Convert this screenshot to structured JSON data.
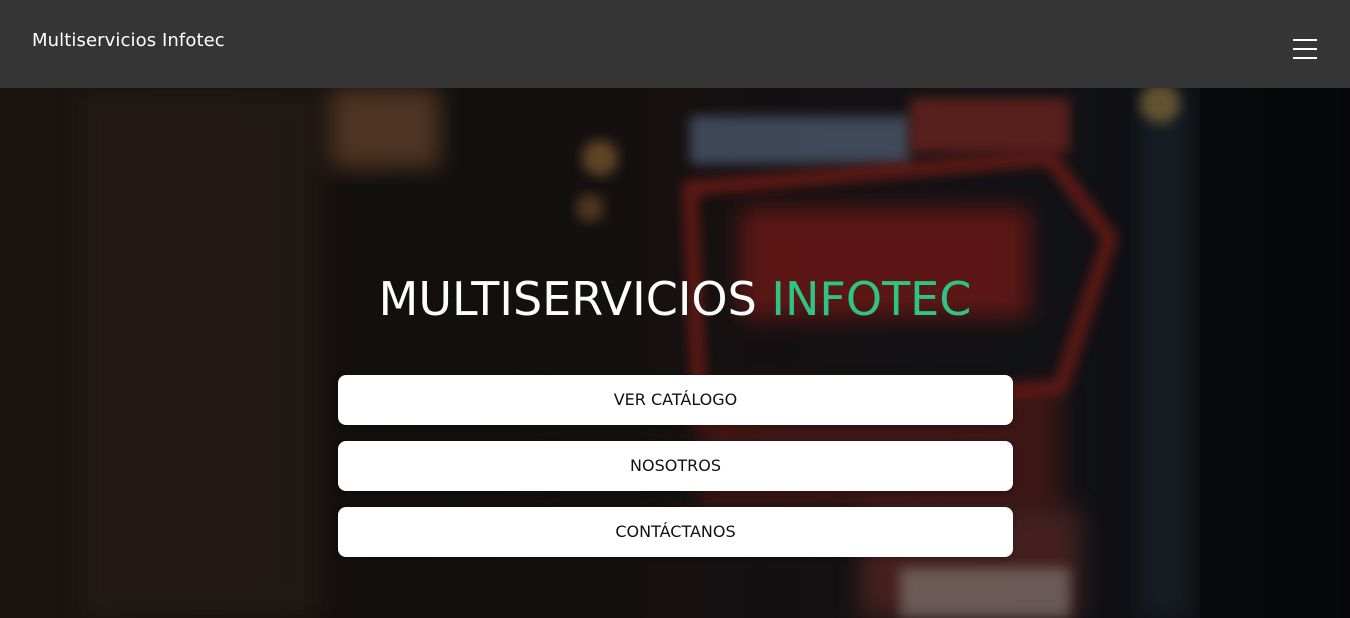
{
  "navbar": {
    "brand": "Multiservicios Infotec",
    "menu_icon": "hamburger-menu-icon"
  },
  "hero": {
    "title_main": "MULTISERVICIOS",
    "title_accent": "INFOTEC",
    "background_description": "blurred storefront photo with neon Black Friday sign",
    "buttons": [
      {
        "label": "VER CATÁLOGO"
      },
      {
        "label": "NOSOTROS"
      },
      {
        "label": "CONTÁCTANOS"
      }
    ]
  },
  "colors": {
    "navbar_bg": "#353535",
    "accent": "#2ec485",
    "button_bg": "#ffffff",
    "button_text": "#111111"
  }
}
